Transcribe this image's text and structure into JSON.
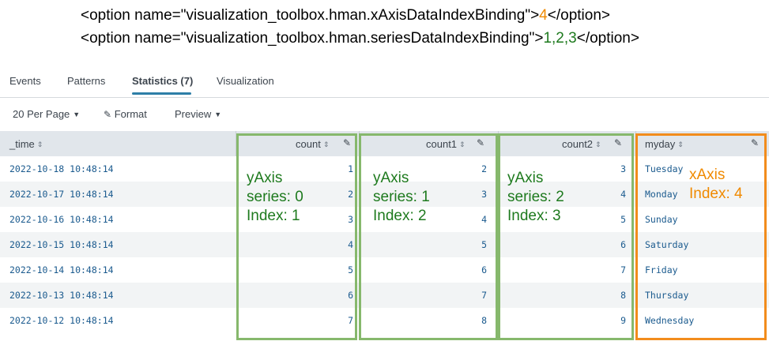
{
  "code": {
    "line1_prefix": "<option name=\"visualization_toolbox.hman.xAxisDataIndexBinding\">",
    "line1_value": "4",
    "line1_suffix": "</option>",
    "line2_prefix": "<option name=\"visualization_toolbox.hman.seriesDataIndexBinding\">",
    "line2_value": "1,2,3",
    "line2_suffix": "</option>"
  },
  "tabs": [
    {
      "label": "Events"
    },
    {
      "label": "Patterns"
    },
    {
      "label": "Statistics (7)"
    },
    {
      "label": "Visualization"
    }
  ],
  "toolbar": {
    "per_page": "20 Per Page",
    "format": "Format",
    "preview": "Preview"
  },
  "table": {
    "columns": [
      "_time",
      "count",
      "count1",
      "count2",
      "myday"
    ],
    "rows": [
      {
        "time": "2022-10-18 10:48:14",
        "count": "1",
        "count1": "2",
        "count2": "3",
        "myday": "Tuesday"
      },
      {
        "time": "2022-10-17 10:48:14",
        "count": "2",
        "count1": "3",
        "count2": "4",
        "myday": "Monday"
      },
      {
        "time": "2022-10-16 10:48:14",
        "count": "3",
        "count1": "4",
        "count2": "5",
        "myday": "Sunday"
      },
      {
        "time": "2022-10-15 10:48:14",
        "count": "4",
        "count1": "5",
        "count2": "6",
        "myday": "Saturday"
      },
      {
        "time": "2022-10-14 10:48:14",
        "count": "5",
        "count1": "6",
        "count2": "7",
        "myday": "Friday"
      },
      {
        "time": "2022-10-13 10:48:14",
        "count": "6",
        "count1": "7",
        "count2": "8",
        "myday": "Thursday"
      },
      {
        "time": "2022-10-12 10:48:14",
        "count": "7",
        "count1": "8",
        "count2": "9",
        "myday": "Wednesday"
      }
    ]
  },
  "annotations": {
    "series0": "yAxis\nseries: 0\nIndex: 1",
    "series1": "yAxis\nseries: 1\nIndex: 2",
    "series2": "yAxis\nseries: 2\nIndex: 3",
    "xaxis": "xAxis\nIndex: 4"
  },
  "colors": {
    "green_box": "#86b86c",
    "orange_box": "#f28c1c",
    "active_tab": "#2d7ea7"
  },
  "icons": {
    "sort": "sort-icon",
    "edit": "pencil-icon",
    "caret": "caret-down-icon"
  }
}
